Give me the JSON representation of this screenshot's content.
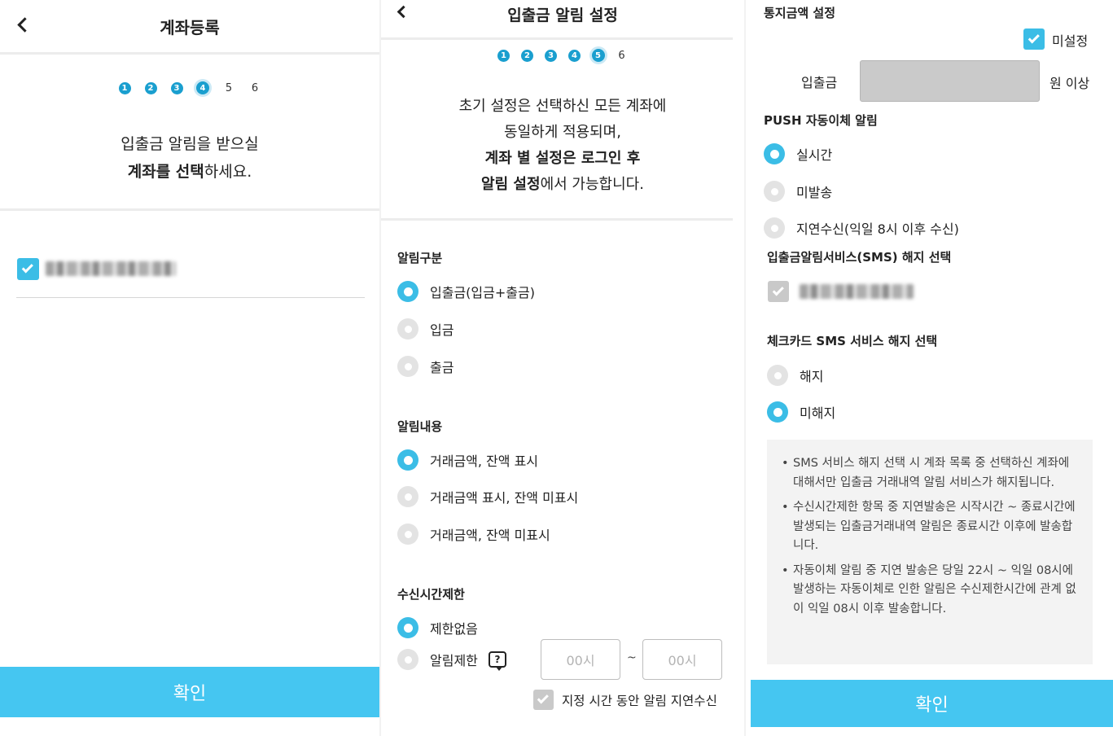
{
  "screen1": {
    "title": "계좌등록",
    "steps": [
      "1",
      "2",
      "3",
      "4",
      "5",
      "6"
    ],
    "instruction_line1": "입출금 알림을 받으실",
    "instruction_bold": "계좌를 선택",
    "instruction_suffix": "하세요.",
    "confirm_label": "확인"
  },
  "screen2": {
    "title": "입출금 알림 설정",
    "steps": [
      "1",
      "2",
      "3",
      "4",
      "5",
      "6"
    ],
    "info_line1": "초기 설정은 선택하신 모든 계좌에",
    "info_line2": "동일하게 적용되며,",
    "info_line3_bold": "계좌 별 설정은 로그인 후",
    "info_line4_bold": "알림 설정",
    "info_line4_suffix": "에서 가능합니다.",
    "alert_type": {
      "title": "알림구분",
      "options": [
        "입출금(입금+출금)",
        "입금",
        "출금"
      ],
      "selected_index": 0
    },
    "alert_content": {
      "title": "알림내용",
      "options": [
        "거래금액, 잔액 표시",
        "거래금액 표시, 잔액 미표시",
        "거래금액, 잔액 미표시"
      ],
      "selected_index": 0
    },
    "time_limit": {
      "title": "수신시간제한",
      "options": [
        "제한없음",
        "알림제한"
      ],
      "selected_index": 0,
      "help_icon": "?",
      "from_placeholder": "00시",
      "tilde": "~",
      "to_placeholder": "00시",
      "delay_checkbox_label": "지정 시간 동안 알림 지연수신"
    }
  },
  "screen3": {
    "amount_setting": {
      "title": "통지금액 설정",
      "unset_label": "미설정",
      "field_label": "입출금",
      "unit_label": "원 이상"
    },
    "push_transfer": {
      "title": "PUSH 자동이체 알림",
      "options": [
        "실시간",
        "미발송",
        "지연수신(익일 8시 이후 수신)"
      ],
      "selected_index": 0
    },
    "sms_cancel": {
      "title": "입출금알림서비스(SMS) 해지 선택"
    },
    "checkcard_sms": {
      "title": "체크카드 SMS 서비스 해지 선택",
      "options": [
        "해지",
        "미해지"
      ],
      "selected_index": 1
    },
    "notes": [
      "SMS 서비스 해지 선택 시 계좌 목록 중 선택하신 계좌에 대해서만 입출금 거래내역 알림 서비스가 해지됩니다.",
      "수신시간제한 항목 중 지연발송은 시작시간 ~ 종료시간에 발생되는 입출금거래내역 알림은 종료시간 이후에 발송합니다.",
      "자동이체 알림 중 지연 발송은 당일 22시 ~ 익일 08시에 발생하는 자동이체로 인한 알림은 수신제한시간에 관계 없이 익일 08시 이후 발송합니다."
    ],
    "confirm_label": "확인"
  },
  "colors": {
    "accent": "#3bbde6",
    "confirm_bar": "#45c6f1",
    "step_blue": "#1a9fcf",
    "note_bg": "#f3f3f3"
  }
}
